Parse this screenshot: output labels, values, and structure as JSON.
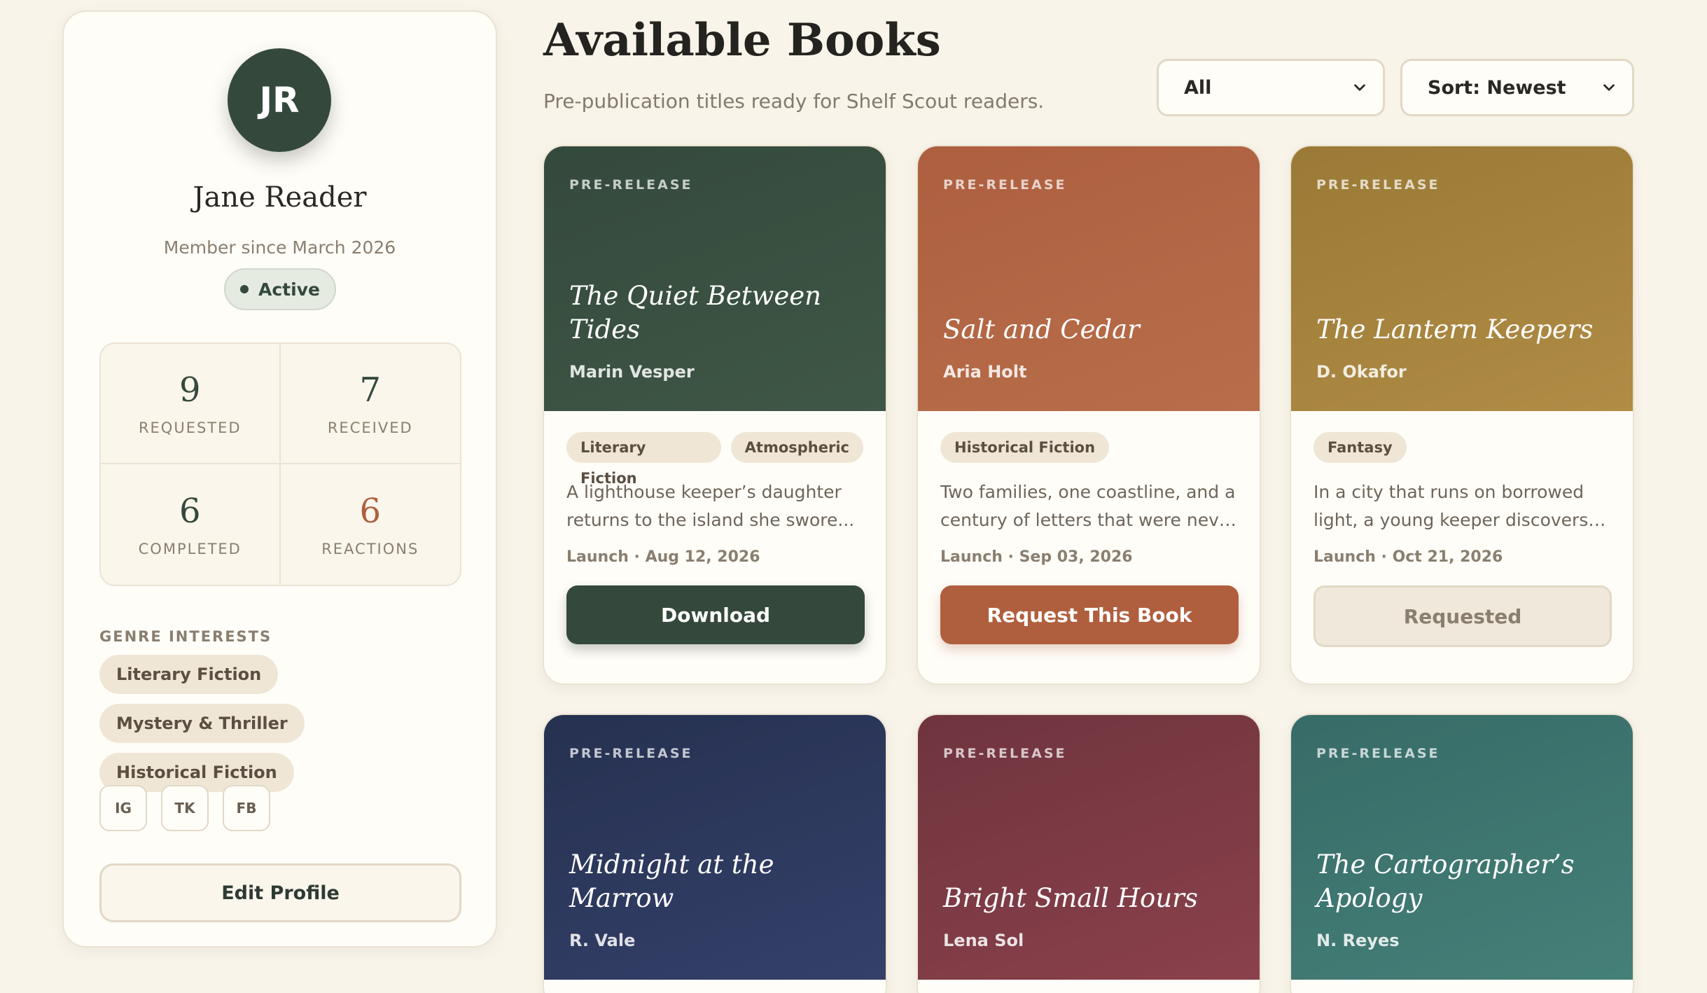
{
  "profile": {
    "initials": "JR",
    "name": "Jane Reader",
    "member_since": "Member since March 2026",
    "status": "Active",
    "stats": [
      {
        "value": "9",
        "label": "REQUESTED"
      },
      {
        "value": "7",
        "label": "RECEIVED"
      },
      {
        "value": "6",
        "label": "COMPLETED"
      },
      {
        "value": "6",
        "label": "REACTIONS"
      }
    ],
    "genre_heading": "GENRE INTERESTS",
    "genres": [
      "Literary Fiction",
      "Mystery & Thriller",
      "Historical Fiction"
    ],
    "socials": [
      "IG",
      "TK",
      "FB"
    ],
    "edit_label": "Edit Profile"
  },
  "header": {
    "title": "Available Books",
    "subtitle": "Pre-publication titles ready for Shelf Scout readers.",
    "filter_value": "All",
    "sort_value": "Sort: Newest"
  },
  "colors": {
    "forest": "#34493c",
    "terracotta": "#b05f3e",
    "ochre": "#a88238",
    "navy": "#2b3655",
    "wine": "#7a3842",
    "teal": "#3e7670"
  },
  "books": [
    {
      "badge": "PRE-RELEASE",
      "title": "The Quiet Between Tides",
      "author": "Marin Vesper",
      "tags": [
        "Literary Fiction",
        "Atmospheric"
      ],
      "desc_line1": "A lighthouse keeper’s daughter",
      "desc_line2": "returns to the island she swore...",
      "launch": "Launch · Aug 12, 2026",
      "action": "Download"
    },
    {
      "badge": "PRE-RELEASE",
      "title": "Salt and Cedar",
      "author": "Aria Holt",
      "tags": [
        "Historical Fiction"
      ],
      "desc_line1": "Two families, one coastline, and a",
      "desc_line2": "century of letters that were never...",
      "launch": "Launch · Sep 03, 2026",
      "action": "Request This Book"
    },
    {
      "badge": "PRE-RELEASE",
      "title": "The Lantern Keepers",
      "author": "D. Okafor",
      "tags": [
        "Fantasy"
      ],
      "desc_line1": "In a city that runs on borrowed",
      "desc_line2": "light, a young keeper discovers th...",
      "launch": "Launch · Oct 21, 2026",
      "action": "Requested"
    },
    {
      "badge": "PRE-RELEASE",
      "title": "Midnight at the Marrow",
      "author": "R. Vale"
    },
    {
      "badge": "PRE-RELEASE",
      "title": "Bright Small Hours",
      "author": "Lena Sol"
    },
    {
      "badge": "PRE-RELEASE",
      "title": "The Cartographer’s Apology",
      "author": "N. Reyes"
    }
  ]
}
